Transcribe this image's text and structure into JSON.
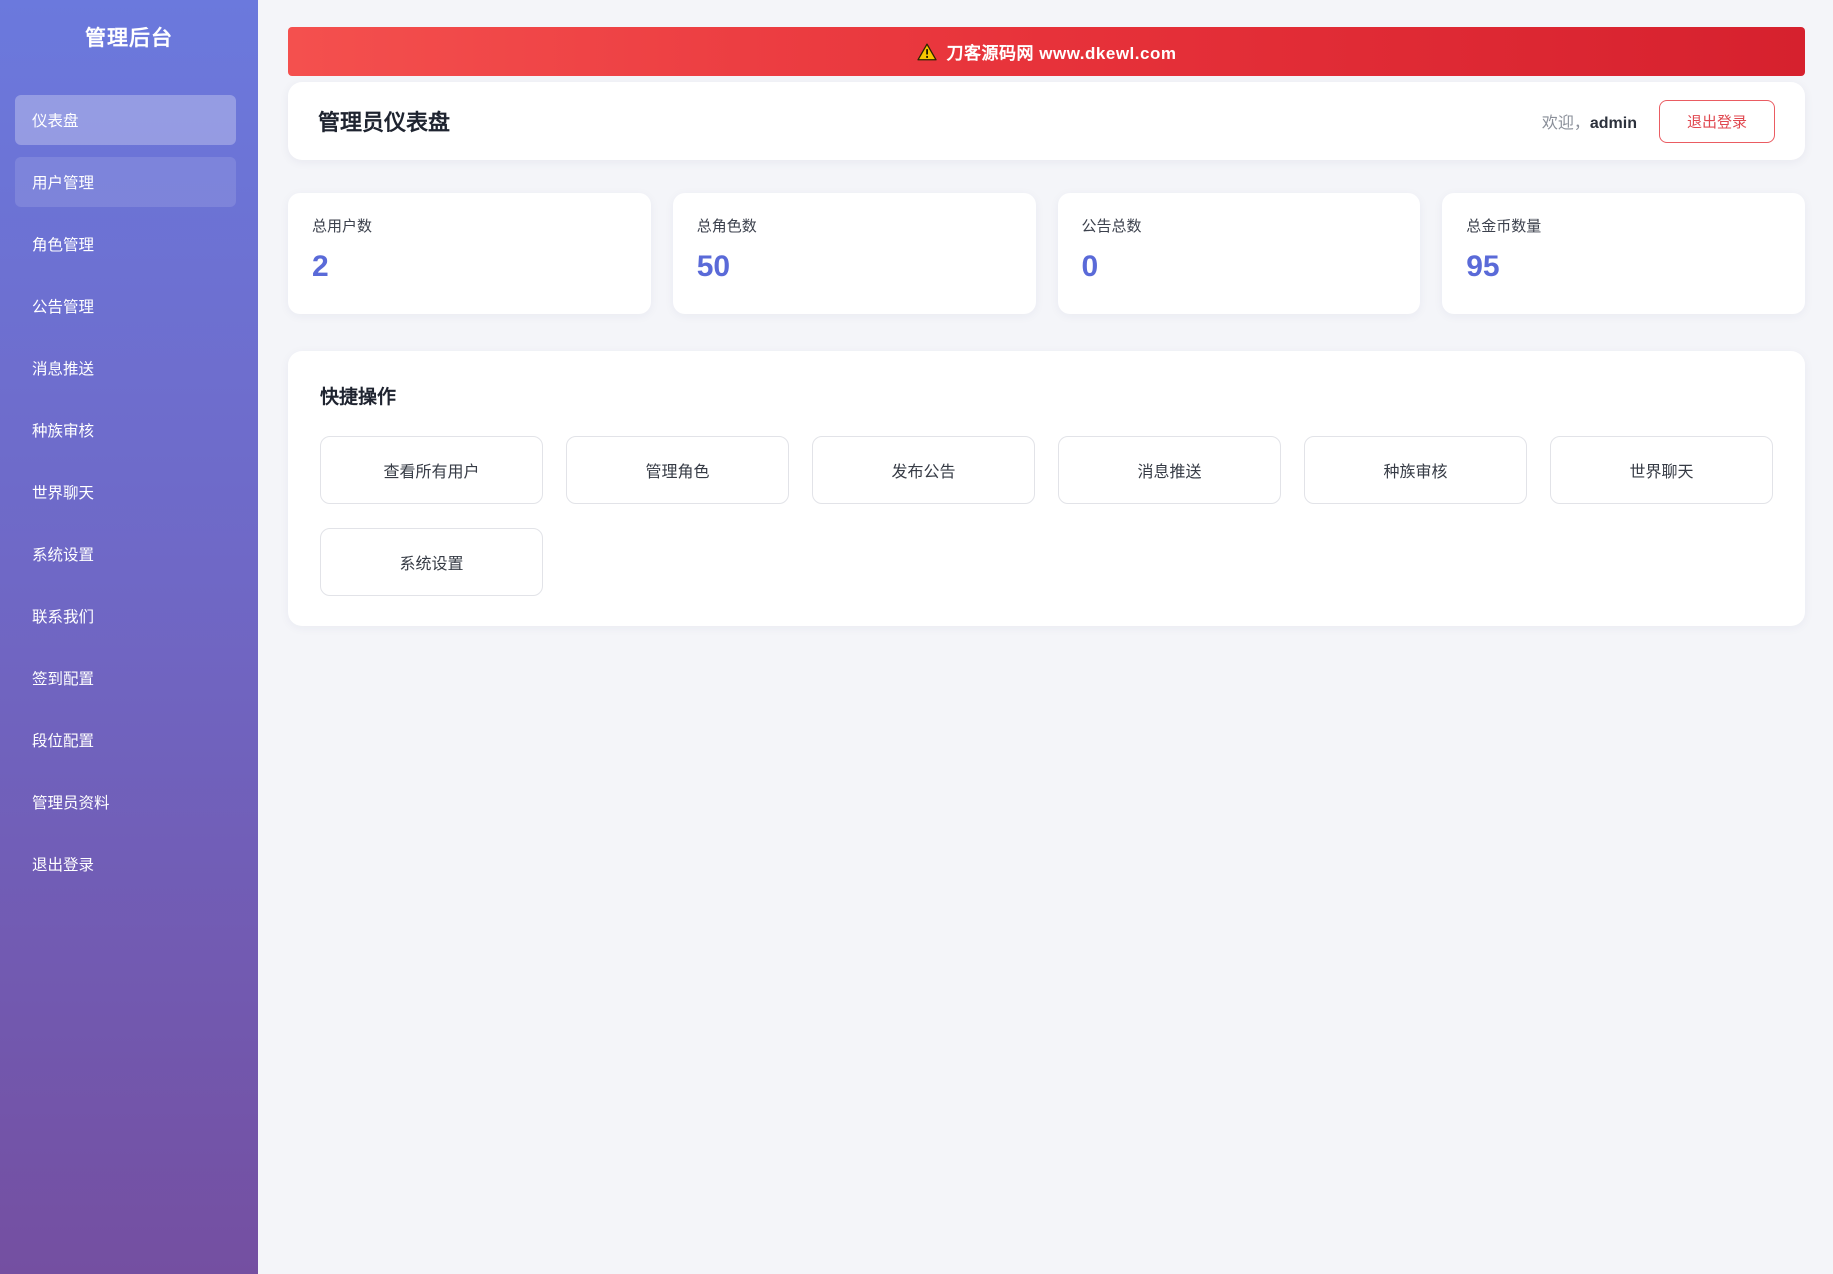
{
  "sidebar": {
    "title": "管理后台",
    "items": [
      {
        "label": "仪表盘",
        "state": "active"
      },
      {
        "label": "用户管理",
        "state": "highlight"
      },
      {
        "label": "角色管理",
        "state": "normal"
      },
      {
        "label": "公告管理",
        "state": "normal"
      },
      {
        "label": "消息推送",
        "state": "normal"
      },
      {
        "label": "种族审核",
        "state": "normal"
      },
      {
        "label": "世界聊天",
        "state": "normal"
      },
      {
        "label": "系统设置",
        "state": "normal"
      },
      {
        "label": "联系我们",
        "state": "normal"
      },
      {
        "label": "签到配置",
        "state": "normal"
      },
      {
        "label": "段位配置",
        "state": "normal"
      },
      {
        "label": "管理员资料",
        "state": "normal"
      },
      {
        "label": "退出登录",
        "state": "normal"
      }
    ]
  },
  "banner": {
    "icon": "warning-icon",
    "text": "刀客源码网 www.dkewl.com",
    "gradient_left": "#f4504e",
    "gradient_right": "#d6212e"
  },
  "header": {
    "title": "管理员仪表盘",
    "welcome_prefix": "欢迎，",
    "username": "admin",
    "logout_label": "退出登录"
  },
  "stats": [
    {
      "label": "总用户数",
      "value": "2"
    },
    {
      "label": "总角色数",
      "value": "50"
    },
    {
      "label": "公告总数",
      "value": "0"
    },
    {
      "label": "总金币数量",
      "value": "95"
    }
  ],
  "quick_actions": {
    "title": "快捷操作",
    "buttons": [
      "查看所有用户",
      "管理角色",
      "发布公告",
      "消息推送",
      "种族审核",
      "世界聊天",
      "系统设置"
    ]
  },
  "colors": {
    "sidebar_gradient_top": "#6b79dd",
    "sidebar_gradient_bottom": "#744fa1",
    "stat_number": "#5a6ad8",
    "logout_red": "#e04850",
    "page_background": "#f4f5f9"
  }
}
